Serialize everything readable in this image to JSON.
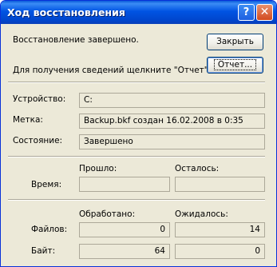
{
  "window": {
    "title": "Ход восстановления",
    "help_glyph": "?",
    "close_glyph": "✕"
  },
  "status": {
    "message": "Восстановление завершено.",
    "report_hint": "Для получения сведений щелкните \"Отчет\"."
  },
  "buttons": {
    "close_label": "Закрыть",
    "report_label": "Отчет..."
  },
  "info": {
    "device_label": "Устройство:",
    "device_value": "C:",
    "label_label": "Метка:",
    "label_value": "Backup.bkf создан 16.02.2008 в 0:35",
    "state_label": "Состояние:",
    "state_value": "Завершено"
  },
  "time": {
    "row_label": "Время:",
    "elapsed_header": "Прошло:",
    "remaining_header": "Осталось:",
    "elapsed_value": "",
    "remaining_value": ""
  },
  "stats": {
    "processed_header": "Обработано:",
    "expected_header": "Ожидалось:",
    "files_label": "Файлов:",
    "files_processed": "0",
    "files_expected": "14",
    "bytes_label": "Байт:",
    "bytes_processed": "64",
    "bytes_expected": "0"
  },
  "colors": {
    "titlebar": "#0054e3",
    "dialog_bg": "#ece9d8",
    "close_button": "#d24a1e"
  }
}
